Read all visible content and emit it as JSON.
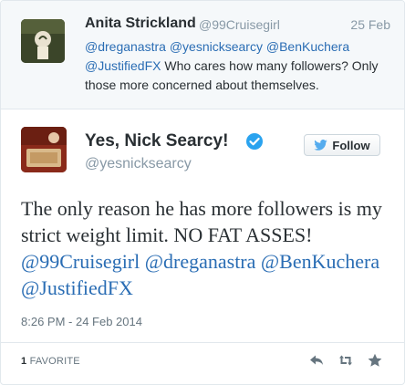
{
  "parent_tweet": {
    "name": "Anita Strickland",
    "handle": "@99Cruisegirl",
    "date": "25 Feb",
    "mentions": [
      "@dreganastra",
      "@yesnicksearcy",
      "@BenKuchera",
      "@JustifiedFX"
    ],
    "body": " Who cares how many followers? Only those more concerned about themselves."
  },
  "main_tweet": {
    "name": "Yes, Nick Searcy!",
    "handle": "@yesnicksearcy",
    "follow_label": "Follow",
    "text_plain": "The only reason he has more followers is my strict weight limit. NO FAT ASSES!",
    "mentions": [
      "@99Cruisegirl",
      "@dreganastra",
      "@BenKuchera",
      "@JustifiedFX"
    ],
    "timestamp": "8:26 PM - 24 Feb 2014"
  },
  "footer": {
    "favorite_count": "1",
    "favorite_label": "FAVORITE"
  },
  "colors": {
    "link": "#2a6db4",
    "muted": "#8899a6",
    "verified": "#2aa3ef"
  }
}
